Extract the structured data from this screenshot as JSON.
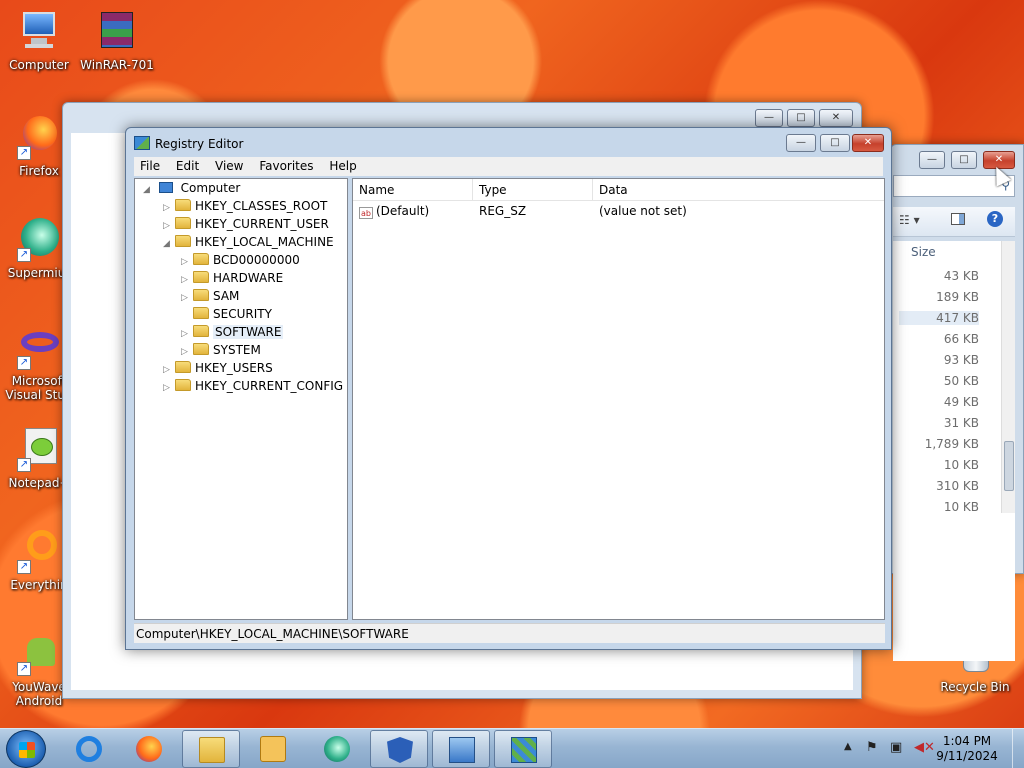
{
  "desktop": {
    "icons": [
      {
        "label": "Computer",
        "icon": "computer-icon"
      },
      {
        "label": "WinRAR-701",
        "icon": "winrar-icon"
      },
      {
        "label": "Firefox",
        "icon": "firefox-icon"
      },
      {
        "label": "Supermiur",
        "icon": "supermium-icon"
      },
      {
        "label": "Microsoft Visual Stud",
        "icon": "visual-studio-icon"
      },
      {
        "label": "Notepad+",
        "icon": "notepadpp-icon"
      },
      {
        "label": "Everythin",
        "icon": "everything-icon"
      },
      {
        "label": "YouWave Android",
        "icon": "youwave-icon"
      },
      {
        "label": "Recycle Bin",
        "icon": "recycle-bin-icon"
      }
    ]
  },
  "explorer": {
    "column_header": "Size",
    "sizes": [
      "43 KB",
      "189 KB",
      "417 KB",
      "66 KB",
      "93 KB",
      "50 KB",
      "49 KB",
      "31 KB",
      "1,789 KB",
      "10 KB",
      "310 KB",
      "10 KB"
    ]
  },
  "regedit": {
    "title": "Registry Editor",
    "menu": [
      "File",
      "Edit",
      "View",
      "Favorites",
      "Help"
    ],
    "tree": {
      "root": "Computer",
      "hives": [
        "HKEY_CLASSES_ROOT",
        "HKEY_CURRENT_USER",
        "HKEY_LOCAL_MACHINE"
      ],
      "hklm_children": [
        "BCD00000000",
        "HARDWARE",
        "SAM",
        "SECURITY",
        "SOFTWARE",
        "SYSTEM"
      ],
      "hives_after": [
        "HKEY_USERS",
        "HKEY_CURRENT_CONFIG"
      ]
    },
    "columns": {
      "name": "Name",
      "type": "Type",
      "data": "Data"
    },
    "values": [
      {
        "name": "(Default)",
        "type": "REG_SZ",
        "data": "(value not set)"
      }
    ],
    "status_path": "Computer\\HKEY_LOCAL_MACHINE\\SOFTWARE"
  },
  "taskbar": {
    "clock_time": "1:04 PM",
    "clock_date": "9/11/2024"
  },
  "colors": {
    "accent": "#1d5fb0",
    "selected_row": "#e5eef8"
  }
}
